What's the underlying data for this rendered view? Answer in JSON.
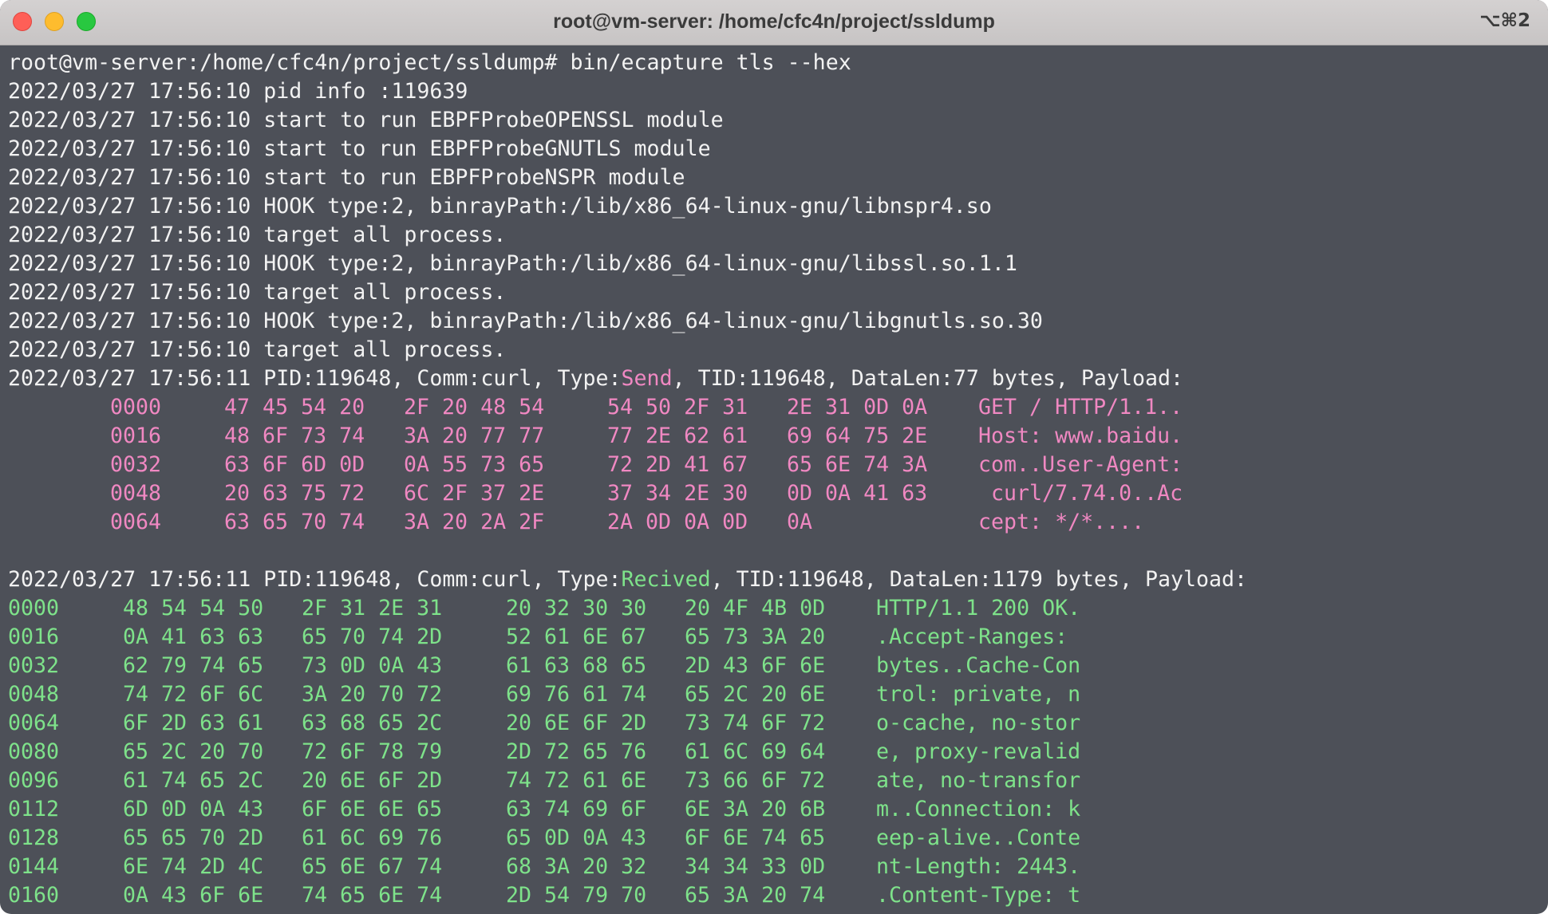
{
  "window": {
    "title": "root@vm-server: /home/cfc4n/project/ssldump",
    "shortcut": "⌥⌘2",
    "colors": {
      "background": "#4d5058",
      "text": "#f2f2f2",
      "send_payload": "#f088c2",
      "recv_payload": "#7ee28a",
      "close": "#fe5f57",
      "minimize": "#febc2e",
      "maximize": "#28c840"
    }
  },
  "terminal": {
    "command_line": "root@vm-server:/home/cfc4n/project/ssldump# bin/ecapture tls --hex",
    "log_lines": [
      "2022/03/27 17:56:10 pid info :119639",
      "2022/03/27 17:56:10 start to run EBPFProbeOPENSSL module",
      "2022/03/27 17:56:10 start to run EBPFProbeGNUTLS module",
      "2022/03/27 17:56:10 start to run EBPFProbeNSPR module",
      "2022/03/27 17:56:10 HOOK type:2, binrayPath:/lib/x86_64-linux-gnu/libnspr4.so",
      "2022/03/27 17:56:10 target all process.",
      "2022/03/27 17:56:10 HOOK type:2, binrayPath:/lib/x86_64-linux-gnu/libssl.so.1.1",
      "2022/03/27 17:56:10 target all process.",
      "2022/03/27 17:56:10 HOOK type:2, binrayPath:/lib/x86_64-linux-gnu/libgnutls.so.30",
      "2022/03/27 17:56:10 target all process."
    ],
    "send_event": {
      "prefix": "2022/03/27 17:56:11 PID:119648, Comm:curl, Type:",
      "type": "Send",
      "suffix": ", TID:119648, DataLen:77 bytes, Payload:",
      "hex_rows": [
        {
          "offset": "0000",
          "g1": "47 45 54 20",
          "g2": "2F 20 48 54",
          "g3": "54 50 2F 31",
          "g4": "2E 31 0D 0A",
          "ascii": "GET / HTTP/1.1.."
        },
        {
          "offset": "0016",
          "g1": "48 6F 73 74",
          "g2": "3A 20 77 77",
          "g3": "77 2E 62 61",
          "g4": "69 64 75 2E",
          "ascii": "Host: www.baidu."
        },
        {
          "offset": "0032",
          "g1": "63 6F 6D 0D",
          "g2": "0A 55 73 65",
          "g3": "72 2D 41 67",
          "g4": "65 6E 74 3A",
          "ascii": "com..User-Agent:"
        },
        {
          "offset": "0048",
          "g1": "20 63 75 72",
          "g2": "6C 2F 37 2E",
          "g3": "37 34 2E 30",
          "g4": "0D 0A 41 63",
          "ascii": " curl/7.74.0..Ac"
        },
        {
          "offset": "0064",
          "g1": "63 65 70 74",
          "g2": "3A 20 2A 2F",
          "g3": "2A 0D 0A 0D",
          "g4": "0A",
          "ascii": "cept: */*...."
        }
      ]
    },
    "recv_event": {
      "prefix": "2022/03/27 17:56:11 PID:119648, Comm:curl, Type:",
      "type": "Recived",
      "suffix": ", TID:119648, DataLen:1179 bytes, Payload:",
      "hex_rows": [
        {
          "offset": "0000",
          "g1": "48 54 54 50",
          "g2": "2F 31 2E 31",
          "g3": "20 32 30 30",
          "g4": "20 4F 4B 0D",
          "ascii": "HTTP/1.1 200 OK."
        },
        {
          "offset": "0016",
          "g1": "0A 41 63 63",
          "g2": "65 70 74 2D",
          "g3": "52 61 6E 67",
          "g4": "65 73 3A 20",
          "ascii": ".Accept-Ranges: "
        },
        {
          "offset": "0032",
          "g1": "62 79 74 65",
          "g2": "73 0D 0A 43",
          "g3": "61 63 68 65",
          "g4": "2D 43 6F 6E",
          "ascii": "bytes..Cache-Con"
        },
        {
          "offset": "0048",
          "g1": "74 72 6F 6C",
          "g2": "3A 20 70 72",
          "g3": "69 76 61 74",
          "g4": "65 2C 20 6E",
          "ascii": "trol: private, n"
        },
        {
          "offset": "0064",
          "g1": "6F 2D 63 61",
          "g2": "63 68 65 2C",
          "g3": "20 6E 6F 2D",
          "g4": "73 74 6F 72",
          "ascii": "o-cache, no-stor"
        },
        {
          "offset": "0080",
          "g1": "65 2C 20 70",
          "g2": "72 6F 78 79",
          "g3": "2D 72 65 76",
          "g4": "61 6C 69 64",
          "ascii": "e, proxy-revalid"
        },
        {
          "offset": "0096",
          "g1": "61 74 65 2C",
          "g2": "20 6E 6F 2D",
          "g3": "74 72 61 6E",
          "g4": "73 66 6F 72",
          "ascii": "ate, no-transfor"
        },
        {
          "offset": "0112",
          "g1": "6D 0D 0A 43",
          "g2": "6F 6E 6E 65",
          "g3": "63 74 69 6F",
          "g4": "6E 3A 20 6B",
          "ascii": "m..Connection: k"
        },
        {
          "offset": "0128",
          "g1": "65 65 70 2D",
          "g2": "61 6C 69 76",
          "g3": "65 0D 0A 43",
          "g4": "6F 6E 74 65",
          "ascii": "eep-alive..Conte"
        },
        {
          "offset": "0144",
          "g1": "6E 74 2D 4C",
          "g2": "65 6E 67 74",
          "g3": "68 3A 20 32",
          "g4": "34 34 33 0D",
          "ascii": "nt-Length: 2443."
        },
        {
          "offset": "0160",
          "g1": "0A 43 6F 6E",
          "g2": "74 65 6E 74",
          "g3": "2D 54 79 70",
          "g4": "65 3A 20 74",
          "ascii": ".Content-Type: t"
        }
      ]
    }
  }
}
